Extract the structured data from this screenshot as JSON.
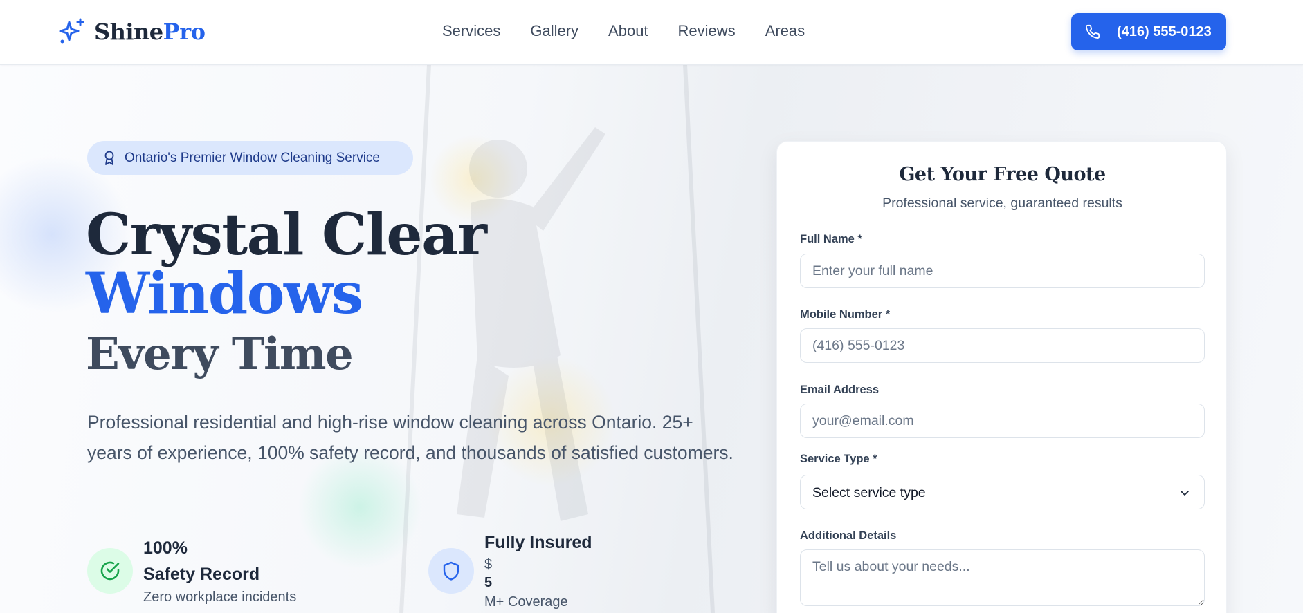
{
  "header": {
    "logo": {
      "part1": "Shine",
      "part2": "Pro",
      "icon": "sparkle-icon"
    },
    "nav": [
      {
        "label": "Services"
      },
      {
        "label": "Gallery"
      },
      {
        "label": "About"
      },
      {
        "label": "Reviews"
      },
      {
        "label": "Areas"
      }
    ],
    "call_button": {
      "label": "(416) 555-0123",
      "icon": "phone-icon"
    }
  },
  "hero": {
    "badge": {
      "label": "Ontario's Premier Window Cleaning Service",
      "icon": "award-icon"
    },
    "headline": {
      "line1": "Crystal Clear",
      "line2": "Windows",
      "line3": "Every Time"
    },
    "description": "Professional residential and high-rise window cleaning across Ontario. 25+ years of experience, 100% safety record, and thousands of satisfied customers.",
    "stats": [
      {
        "icon": "check-circle-icon",
        "value": "100%",
        "title": "Safety Record",
        "subtitle": "Zero workplace incidents"
      },
      {
        "icon": "shield-icon",
        "title": "Fully Insured",
        "prefix": "$",
        "value": "5",
        "subtitle": "M+ Coverage"
      }
    ]
  },
  "quote_form": {
    "title": "Get Your Free Quote",
    "subtitle": "Professional service, guaranteed results",
    "fields": {
      "name": {
        "label": "Full Name *",
        "placeholder": "Enter your full name"
      },
      "mobile": {
        "label": "Mobile Number *",
        "placeholder": "(416) 555-0123"
      },
      "email": {
        "label": "Email Address",
        "placeholder": "your@email.com"
      },
      "service": {
        "label": "Service Type *",
        "selected": "Select service type"
      },
      "details": {
        "label": "Additional Details",
        "placeholder": "Tell us about your needs..."
      }
    }
  },
  "colors": {
    "accent": "#2563eb",
    "heading": "#1e293b",
    "muted": "#475569",
    "badge_bg": "#dbe7fd",
    "success_bg": "#dcfce7",
    "success": "#16a34a"
  }
}
